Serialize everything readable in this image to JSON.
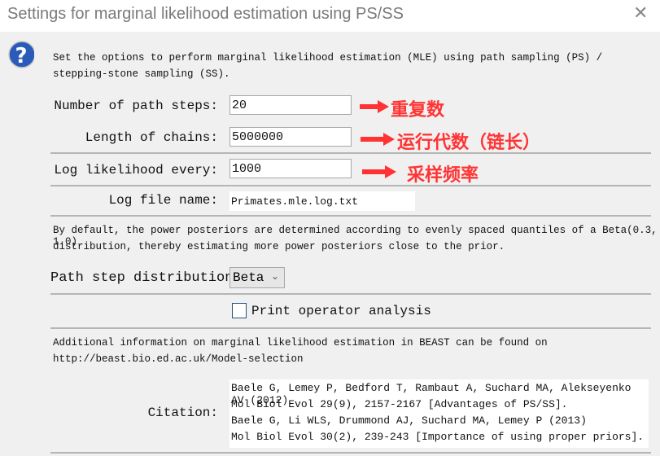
{
  "window": {
    "title": "Settings for marginal likelihood estimation using PS/SS",
    "close_icon": "close-icon"
  },
  "intro": {
    "icon": "question-icon",
    "line1": "Set the options to perform marginal likelihood estimation (MLE) using path sampling (PS) /",
    "line2": "stepping-stone sampling (SS)."
  },
  "fields": {
    "path_steps": {
      "label": "Number of path steps:",
      "value": "20",
      "annotation": "重复数"
    },
    "chain_length": {
      "label": "Length of chains:",
      "value": "5000000",
      "annotation": "运行代数（链长）"
    },
    "log_every": {
      "label": "Log likelihood every:",
      "value": "1000",
      "annotation": "采样频率"
    },
    "log_file": {
      "label": "Log file name:",
      "value": "Primates.mle.log.txt"
    }
  },
  "default_note": {
    "line1": "By default, the power posteriors are determined according to evenly spaced quantiles of a Beta(0.3, 1.0)",
    "line2": "distribution, thereby estimating more power posteriors close to the prior."
  },
  "distribution": {
    "label": "Path step distribution:",
    "selected": "Beta"
  },
  "print_operator": {
    "label": "Print operator analysis",
    "checked": false
  },
  "info": {
    "line1": "Additional information on marginal likelihood estimation in BEAST can be found on",
    "line2": "http://beast.bio.ed.ac.uk/Model-selection"
  },
  "citation": {
    "label": "Citation:",
    "lines": [
      "Baele G, Lemey P, Bedford T, Rambaut A, Suchard MA, Alekseyenko AV (2012)",
      "Mol Biol Evol 29(9), 2157-2167 [Advantages of PS/SS].",
      "Baele G, Li WLS, Drummond AJ, Suchard MA, Lemey P (2013)",
      "Mol Biol Evol 30(2), 239-243 [Importance of using proper priors]."
    ]
  },
  "colors": {
    "annotation": "#ff3333",
    "checkbox_border": "#2a4f7a"
  }
}
